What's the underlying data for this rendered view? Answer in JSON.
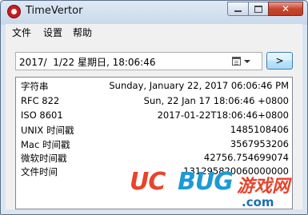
{
  "window": {
    "title": "TimeVertor",
    "close_glyph": "✕"
  },
  "menu": {
    "items": [
      "文件",
      "设置",
      "帮助"
    ]
  },
  "datetime_picker": {
    "value": "2017/  1/22 星期日, 18:06:46",
    "icon": "calendar-icon"
  },
  "go_button": {
    "label": ">"
  },
  "results": [
    {
      "label": "字符串",
      "value": "Sunday, January 22, 2017 06:06:46 PM"
    },
    {
      "label": "RFC 822",
      "value": "Sun, 22 Jan 17 18:06:46 +0800"
    },
    {
      "label": "ISO 8601",
      "value": "2017-01-22T18:06:46+0800"
    },
    {
      "label": "UNIX 时间戳",
      "value": "1485108406"
    },
    {
      "label": "Mac 时间戳",
      "value": "3567953206"
    },
    {
      "label": "微软时间戳",
      "value": "42756.754699074"
    },
    {
      "label": "文件时间",
      "value": "131295820060000000"
    }
  ],
  "watermark": {
    "uc": "UC",
    "bug": "BUG",
    "cn": "游戏网",
    "domain": ".com"
  },
  "colors": {
    "accent_red": "#e8442c",
    "accent_blue": "#1d9ad6"
  }
}
